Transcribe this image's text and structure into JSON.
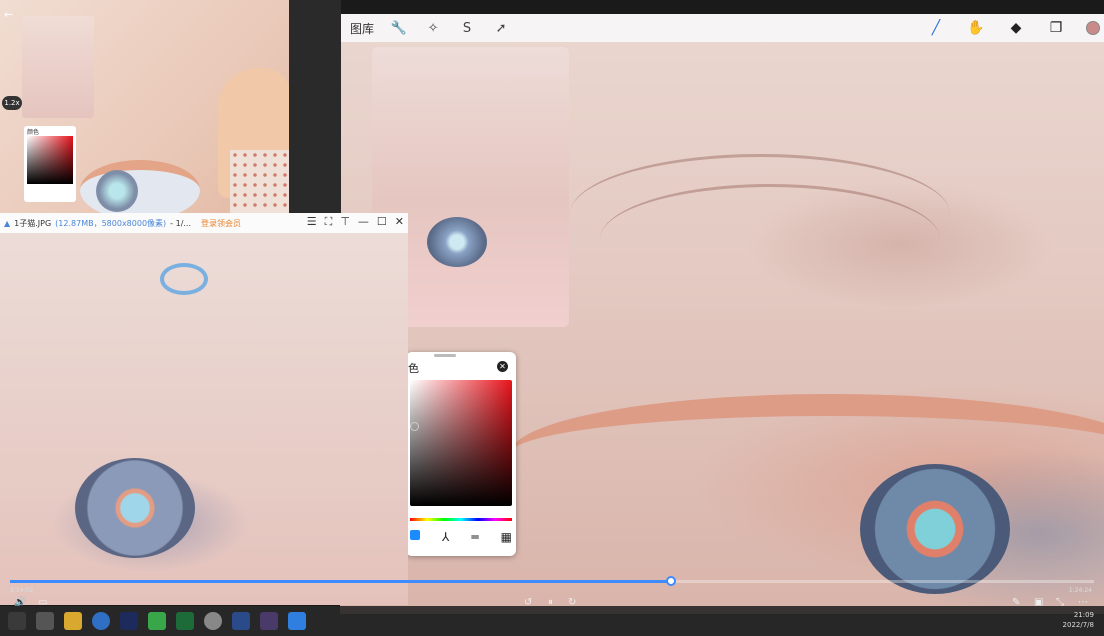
{
  "procreate": {
    "gallery_label": "图库",
    "tools_left": [
      "wrench-icon",
      "magic-wand-icon",
      "selection-icon",
      "transform-icon"
    ],
    "tools_right": [
      "brush-icon",
      "smudge-icon",
      "eraser-icon",
      "layers-icon"
    ],
    "current_color": "#c98a8a"
  },
  "color_picker": {
    "title": "色",
    "close_glyph": "✕"
  },
  "camera_feed": {
    "zoom_label": "1.2x",
    "mini_picker_title": "颜色"
  },
  "viewer": {
    "file_name": "1子猫.JPG",
    "file_meta": "(12.87MB，5800x8000像素)",
    "page_info": "- 1/...",
    "login_label": "登录领会员",
    "controls": [
      "☰",
      "⛶",
      "⊤",
      "—",
      "☐",
      "✕"
    ]
  },
  "video": {
    "elapsed": "2:14:02",
    "total": "1:24:24",
    "progress_fraction": 0.61,
    "clock_time": "21:09",
    "clock_date": "2022/7/8"
  },
  "accent": "#3d8bff"
}
